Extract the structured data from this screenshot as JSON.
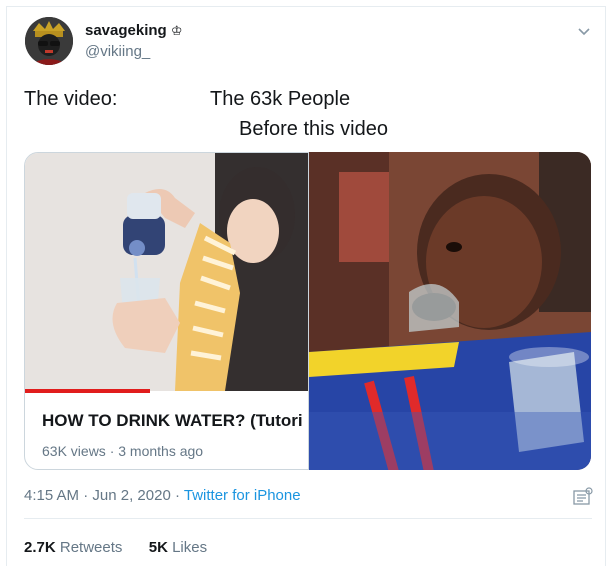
{
  "user": {
    "display_name": "savageking",
    "name_emoji": "♔",
    "handle": "@vikiing_"
  },
  "tweet": {
    "line1_left": "The video:",
    "line1_right": "The 63k People",
    "line2_right": "Before this video"
  },
  "video_card": {
    "title": "HOW TO DRINK WATER? (Tutori",
    "meta": "63K views · 3 months ago",
    "watched_fraction": 0.44
  },
  "meta": {
    "time": "4:15 AM",
    "separator": " · ",
    "date": "Jun 2, 2020",
    "source": "Twitter for iPhone"
  },
  "stats": {
    "retweets_count": "2.7K",
    "retweets_label": "Retweets",
    "likes_count": "5K",
    "likes_label": "Likes"
  },
  "icons": {
    "caret": "chevron-down-icon",
    "app": "twitter-app-icon"
  },
  "colors": {
    "text": "#14171a",
    "secondary": "#657786",
    "link": "#1b95e0",
    "progress": "#e11d1d",
    "border": "#e6ecf0"
  }
}
